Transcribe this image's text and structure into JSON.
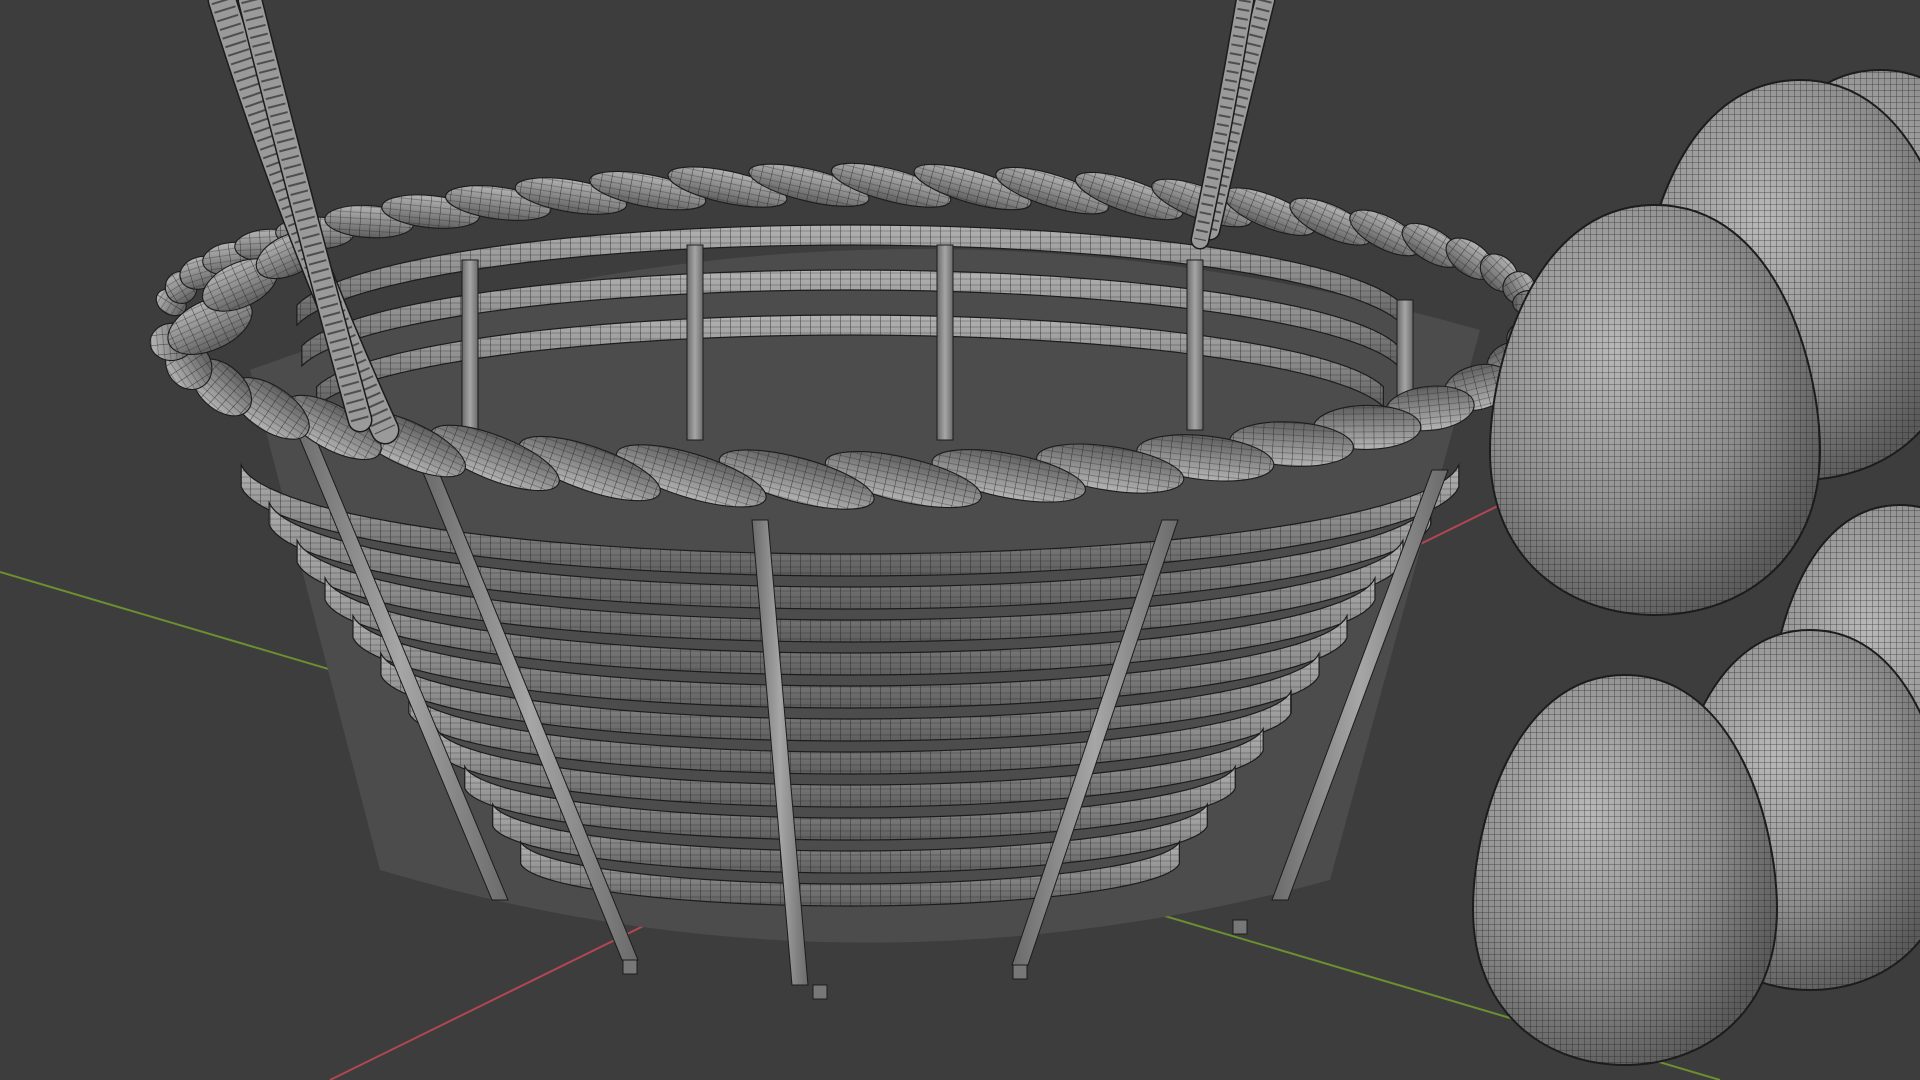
{
  "viewport": {
    "mode": "wireframe-overlay",
    "shading": "solid",
    "colors": {
      "background": "#3d3d3d",
      "mesh_fill": "#8a8a8a",
      "mesh_fill_light": "#a8a8a8",
      "mesh_fill_dark": "#5e5e5e",
      "wire": "#1c1c1c",
      "axis_x": "#b24653",
      "axis_y": "#6c8f2f"
    }
  },
  "scene": {
    "objects": [
      {
        "name_icon": "basket-mesh",
        "kind": "wicker basket with twisted rim and handle"
      },
      {
        "name_icon": "egg-mesh",
        "kind": "egg",
        "count": 6
      }
    ]
  }
}
